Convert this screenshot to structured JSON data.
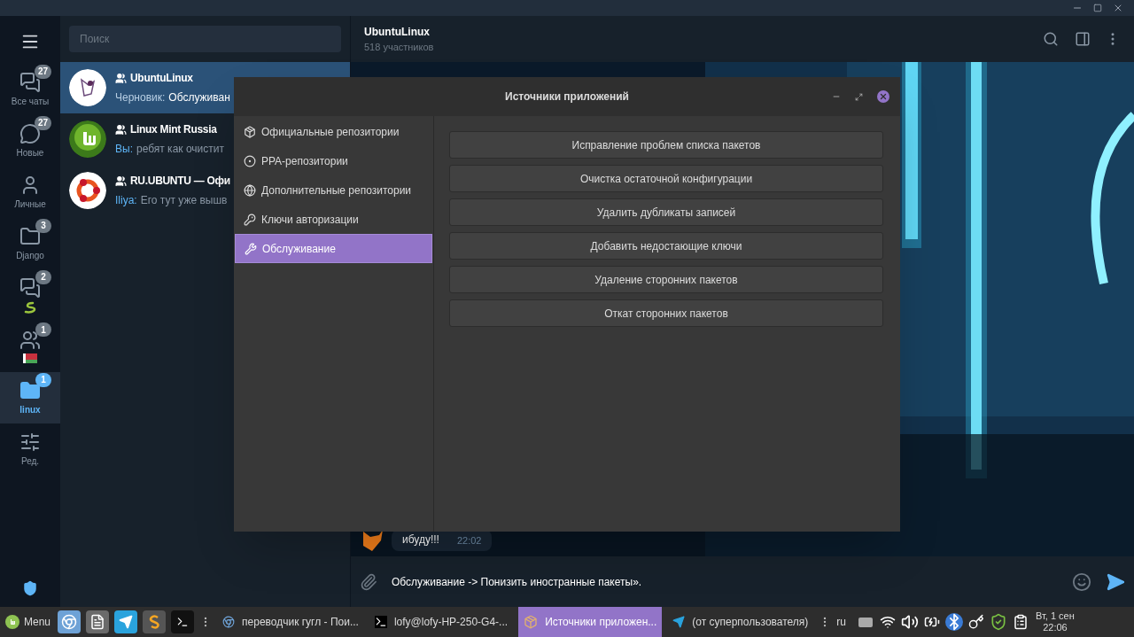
{
  "rail": {
    "items": [
      {
        "label": "Все чаты",
        "badge": "27",
        "selected": false
      },
      {
        "label": "Новые",
        "badge": "27",
        "selected": false
      },
      {
        "label": "Личные",
        "selected": false
      },
      {
        "label": "Django",
        "badge": "3",
        "selected": false
      },
      {
        "badge": "2",
        "selected": false
      },
      {
        "badge": "1",
        "selected": false
      },
      {
        "label": "linux",
        "badge": "1",
        "selected": true
      },
      {
        "label": "Ред.",
        "selected": false
      }
    ]
  },
  "search": {
    "placeholder": "Поиск"
  },
  "chats": [
    {
      "name": "UbuntuLinux",
      "prefix": "Черновик:",
      "preview": "Обслуживан",
      "selected": true
    },
    {
      "name": "Linux Mint Russia",
      "prefix": "Вы:",
      "preview": "ребят как очистит",
      "selected": false
    },
    {
      "name": "RU.UBUNTU — Офи",
      "prefix": "Iliya:",
      "preview": "Его тут уже вышв",
      "selected": false
    }
  ],
  "chat": {
    "title": "UbuntuLinux",
    "subtitle": "518 участников",
    "message": {
      "text": "ибуду!!!",
      "time": "22:02"
    },
    "draft": "Обслуживание -> Понизить иностранные пакеты»."
  },
  "dialog": {
    "title": "Источники приложений",
    "nav": [
      {
        "label": "Официальные репозитории",
        "selected": false
      },
      {
        "label": "PPA-репозитории",
        "selected": false
      },
      {
        "label": "Дополнительные репозитории",
        "selected": false
      },
      {
        "label": "Ключи авторизации",
        "selected": false
      },
      {
        "label": "Обслуживание",
        "selected": true
      }
    ],
    "actions": [
      "Исправление проблем списка пакетов",
      "Очистка остаточной конфигурации",
      "Удалить дубликаты записей",
      "Добавить недостающие ключи",
      "Удаление сторонних пакетов",
      "Откат сторонних пакетов"
    ]
  },
  "taskbar": {
    "menu": "Menu",
    "windows": [
      {
        "label": "переводчик гугл - Пои...",
        "selected": false
      },
      {
        "label": "lofy@lofy-HP-250-G4-...",
        "selected": false
      },
      {
        "label": "Источники приложен...",
        "selected": true
      },
      {
        "label": "(от суперпользователя)",
        "selected": false
      }
    ],
    "layout": "ru",
    "date": "Вт, 1 сен",
    "time": "22:06"
  }
}
